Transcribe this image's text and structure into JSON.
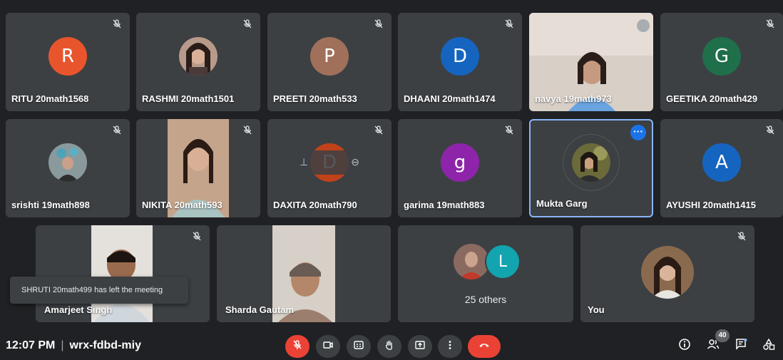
{
  "participants": [
    {
      "name": "RITU 20math1568",
      "initial": "R",
      "color": "#e8552d"
    },
    {
      "name": "RASHMI 20math1501"
    },
    {
      "name": "PREETI 20math533",
      "initial": "P",
      "color": "#a1705a"
    },
    {
      "name": "DHAANI 20math1474",
      "initial": "D",
      "color": "#1565c0"
    },
    {
      "name": "navya 19math973"
    },
    {
      "name": "GEETIKA 20math429",
      "initial": "G",
      "color": "#1e6f4a"
    },
    {
      "name": "srishti 19math898"
    },
    {
      "name": "NIKITA 20math593"
    },
    {
      "name": "DAXITA 20math790",
      "initial": "D",
      "color": "#d84315"
    },
    {
      "name": "garima 19math883",
      "initial": "g",
      "color": "#8e24aa"
    },
    {
      "name": "Mukta Garg"
    },
    {
      "name": "AYUSHI 20math1415",
      "initial": "A",
      "color": "#1565c0"
    },
    {
      "name": "Amarjeet Singh"
    },
    {
      "name": "Sharda Gautam"
    },
    {
      "name": "You"
    }
  ],
  "others": {
    "label": "25 others",
    "initial": "L",
    "color": "#12a4af"
  },
  "toast": "SHRUTI 20math499 has left the meeting",
  "meeting": {
    "time": "12:07 PM",
    "separator": "|",
    "code": "wrx-fdbd-miy"
  },
  "people_count": "40",
  "icons": {
    "mic_off": "mic-off-icon",
    "camera": "camera-icon",
    "captions": "captions-icon",
    "raise_hand": "raise-hand-icon",
    "present": "present-screen-icon",
    "more": "more-options-icon",
    "end_call": "end-call-icon",
    "info": "info-icon",
    "people": "people-icon",
    "chat": "chat-icon",
    "activities": "activities-icon"
  },
  "colors": {
    "end_call": "#ea4335",
    "active_border": "#8ab4f8",
    "tile_bg": "#3c4043",
    "bg": "#202124"
  }
}
